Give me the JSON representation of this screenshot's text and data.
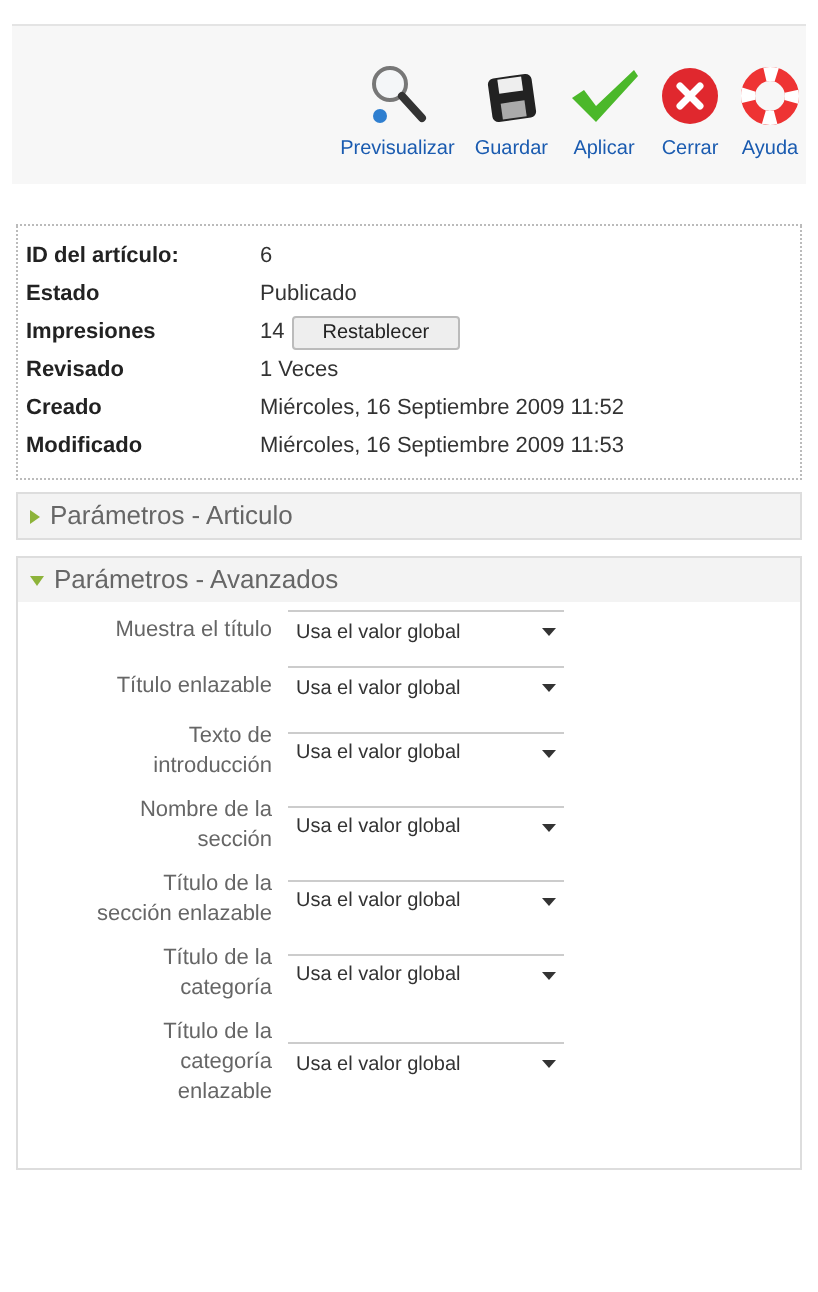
{
  "toolbar": [
    {
      "kind": "preview",
      "label": "Previsualizar"
    },
    {
      "kind": "save",
      "label": "Guardar"
    },
    {
      "kind": "apply",
      "label": "Aplicar"
    },
    {
      "kind": "close",
      "label": "Cerrar"
    },
    {
      "kind": "help",
      "label": "Ayuda"
    }
  ],
  "info": [
    {
      "label": "ID del artículo:",
      "value": "6"
    },
    {
      "label": "Estado",
      "value": "Publicado"
    },
    {
      "label": "Impresiones",
      "value": "14",
      "button": "Restablecer"
    },
    {
      "label": "Revisado",
      "value": "1 Veces"
    },
    {
      "label": "Creado",
      "value": "Miércoles, 16 Septiembre 2009 11:52"
    },
    {
      "label": "Modificado",
      "value": "Miércoles, 16 Septiembre 2009 11:53"
    }
  ],
  "panels": [
    {
      "title": "Parámetros - Articulo",
      "expanded": false
    },
    {
      "title": "Parámetros - Avanzados",
      "expanded": true,
      "fields": [
        {
          "label": "Muestra el título",
          "value": "Usa el valor global"
        },
        {
          "label": "Título enlazable",
          "value": "Usa el valor global"
        },
        {
          "label": "Texto de introducción",
          "value": "Usa el valor global"
        },
        {
          "label": "Nombre de la sección",
          "value": "Usa el valor global"
        },
        {
          "label": "Título de la sección enlazable",
          "value": "Usa el valor global"
        },
        {
          "label": "Título de la categoría",
          "value": "Usa el valor global"
        },
        {
          "label": "Título de la categoría enlazable",
          "value": "Usa el valor global"
        }
      ]
    }
  ]
}
